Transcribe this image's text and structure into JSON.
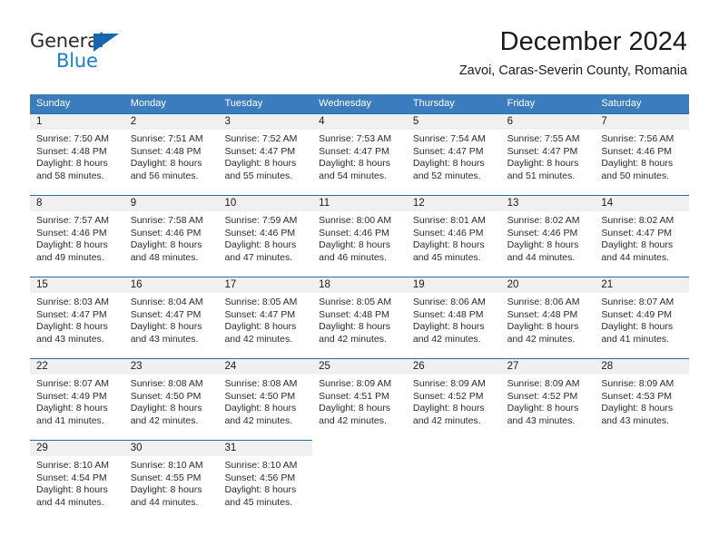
{
  "logo": {
    "word_general": "General",
    "word_blue": "Blue",
    "triangle_color": "#1565b0",
    "blue_text_color": "#1a7ec8"
  },
  "header": {
    "month_title": "December 2024",
    "location": "Zavoi, Caras-Severin County, Romania"
  },
  "theme": {
    "header_blue": "#3a7cbe",
    "cell_border_blue": "#2e6da4",
    "daynum_band_gray": "#f0f0f0"
  },
  "weekdays": [
    "Sunday",
    "Monday",
    "Tuesday",
    "Wednesday",
    "Thursday",
    "Friday",
    "Saturday"
  ],
  "weeks": [
    [
      {
        "day": "1",
        "sunrise": "Sunrise: 7:50 AM",
        "sunset": "Sunset: 4:48 PM",
        "daylight1": "Daylight: 8 hours",
        "daylight2": "and 58 minutes."
      },
      {
        "day": "2",
        "sunrise": "Sunrise: 7:51 AM",
        "sunset": "Sunset: 4:48 PM",
        "daylight1": "Daylight: 8 hours",
        "daylight2": "and 56 minutes."
      },
      {
        "day": "3",
        "sunrise": "Sunrise: 7:52 AM",
        "sunset": "Sunset: 4:47 PM",
        "daylight1": "Daylight: 8 hours",
        "daylight2": "and 55 minutes."
      },
      {
        "day": "4",
        "sunrise": "Sunrise: 7:53 AM",
        "sunset": "Sunset: 4:47 PM",
        "daylight1": "Daylight: 8 hours",
        "daylight2": "and 54 minutes."
      },
      {
        "day": "5",
        "sunrise": "Sunrise: 7:54 AM",
        "sunset": "Sunset: 4:47 PM",
        "daylight1": "Daylight: 8 hours",
        "daylight2": "and 52 minutes."
      },
      {
        "day": "6",
        "sunrise": "Sunrise: 7:55 AM",
        "sunset": "Sunset: 4:47 PM",
        "daylight1": "Daylight: 8 hours",
        "daylight2": "and 51 minutes."
      },
      {
        "day": "7",
        "sunrise": "Sunrise: 7:56 AM",
        "sunset": "Sunset: 4:46 PM",
        "daylight1": "Daylight: 8 hours",
        "daylight2": "and 50 minutes."
      }
    ],
    [
      {
        "day": "8",
        "sunrise": "Sunrise: 7:57 AM",
        "sunset": "Sunset: 4:46 PM",
        "daylight1": "Daylight: 8 hours",
        "daylight2": "and 49 minutes."
      },
      {
        "day": "9",
        "sunrise": "Sunrise: 7:58 AM",
        "sunset": "Sunset: 4:46 PM",
        "daylight1": "Daylight: 8 hours",
        "daylight2": "and 48 minutes."
      },
      {
        "day": "10",
        "sunrise": "Sunrise: 7:59 AM",
        "sunset": "Sunset: 4:46 PM",
        "daylight1": "Daylight: 8 hours",
        "daylight2": "and 47 minutes."
      },
      {
        "day": "11",
        "sunrise": "Sunrise: 8:00 AM",
        "sunset": "Sunset: 4:46 PM",
        "daylight1": "Daylight: 8 hours",
        "daylight2": "and 46 minutes."
      },
      {
        "day": "12",
        "sunrise": "Sunrise: 8:01 AM",
        "sunset": "Sunset: 4:46 PM",
        "daylight1": "Daylight: 8 hours",
        "daylight2": "and 45 minutes."
      },
      {
        "day": "13",
        "sunrise": "Sunrise: 8:02 AM",
        "sunset": "Sunset: 4:46 PM",
        "daylight1": "Daylight: 8 hours",
        "daylight2": "and 44 minutes."
      },
      {
        "day": "14",
        "sunrise": "Sunrise: 8:02 AM",
        "sunset": "Sunset: 4:47 PM",
        "daylight1": "Daylight: 8 hours",
        "daylight2": "and 44 minutes."
      }
    ],
    [
      {
        "day": "15",
        "sunrise": "Sunrise: 8:03 AM",
        "sunset": "Sunset: 4:47 PM",
        "daylight1": "Daylight: 8 hours",
        "daylight2": "and 43 minutes."
      },
      {
        "day": "16",
        "sunrise": "Sunrise: 8:04 AM",
        "sunset": "Sunset: 4:47 PM",
        "daylight1": "Daylight: 8 hours",
        "daylight2": "and 43 minutes."
      },
      {
        "day": "17",
        "sunrise": "Sunrise: 8:05 AM",
        "sunset": "Sunset: 4:47 PM",
        "daylight1": "Daylight: 8 hours",
        "daylight2": "and 42 minutes."
      },
      {
        "day": "18",
        "sunrise": "Sunrise: 8:05 AM",
        "sunset": "Sunset: 4:48 PM",
        "daylight1": "Daylight: 8 hours",
        "daylight2": "and 42 minutes."
      },
      {
        "day": "19",
        "sunrise": "Sunrise: 8:06 AM",
        "sunset": "Sunset: 4:48 PM",
        "daylight1": "Daylight: 8 hours",
        "daylight2": "and 42 minutes."
      },
      {
        "day": "20",
        "sunrise": "Sunrise: 8:06 AM",
        "sunset": "Sunset: 4:48 PM",
        "daylight1": "Daylight: 8 hours",
        "daylight2": "and 42 minutes."
      },
      {
        "day": "21",
        "sunrise": "Sunrise: 8:07 AM",
        "sunset": "Sunset: 4:49 PM",
        "daylight1": "Daylight: 8 hours",
        "daylight2": "and 41 minutes."
      }
    ],
    [
      {
        "day": "22",
        "sunrise": "Sunrise: 8:07 AM",
        "sunset": "Sunset: 4:49 PM",
        "daylight1": "Daylight: 8 hours",
        "daylight2": "and 41 minutes."
      },
      {
        "day": "23",
        "sunrise": "Sunrise: 8:08 AM",
        "sunset": "Sunset: 4:50 PM",
        "daylight1": "Daylight: 8 hours",
        "daylight2": "and 42 minutes."
      },
      {
        "day": "24",
        "sunrise": "Sunrise: 8:08 AM",
        "sunset": "Sunset: 4:50 PM",
        "daylight1": "Daylight: 8 hours",
        "daylight2": "and 42 minutes."
      },
      {
        "day": "25",
        "sunrise": "Sunrise: 8:09 AM",
        "sunset": "Sunset: 4:51 PM",
        "daylight1": "Daylight: 8 hours",
        "daylight2": "and 42 minutes."
      },
      {
        "day": "26",
        "sunrise": "Sunrise: 8:09 AM",
        "sunset": "Sunset: 4:52 PM",
        "daylight1": "Daylight: 8 hours",
        "daylight2": "and 42 minutes."
      },
      {
        "day": "27",
        "sunrise": "Sunrise: 8:09 AM",
        "sunset": "Sunset: 4:52 PM",
        "daylight1": "Daylight: 8 hours",
        "daylight2": "and 43 minutes."
      },
      {
        "day": "28",
        "sunrise": "Sunrise: 8:09 AM",
        "sunset": "Sunset: 4:53 PM",
        "daylight1": "Daylight: 8 hours",
        "daylight2": "and 43 minutes."
      }
    ],
    [
      {
        "day": "29",
        "sunrise": "Sunrise: 8:10 AM",
        "sunset": "Sunset: 4:54 PM",
        "daylight1": "Daylight: 8 hours",
        "daylight2": "and 44 minutes."
      },
      {
        "day": "30",
        "sunrise": "Sunrise: 8:10 AM",
        "sunset": "Sunset: 4:55 PM",
        "daylight1": "Daylight: 8 hours",
        "daylight2": "and 44 minutes."
      },
      {
        "day": "31",
        "sunrise": "Sunrise: 8:10 AM",
        "sunset": "Sunset: 4:56 PM",
        "daylight1": "Daylight: 8 hours",
        "daylight2": "and 45 minutes."
      },
      {
        "day": "",
        "sunrise": "",
        "sunset": "",
        "daylight1": "",
        "daylight2": ""
      },
      {
        "day": "",
        "sunrise": "",
        "sunset": "",
        "daylight1": "",
        "daylight2": ""
      },
      {
        "day": "",
        "sunrise": "",
        "sunset": "",
        "daylight1": "",
        "daylight2": ""
      },
      {
        "day": "",
        "sunrise": "",
        "sunset": "",
        "daylight1": "",
        "daylight2": ""
      }
    ]
  ]
}
